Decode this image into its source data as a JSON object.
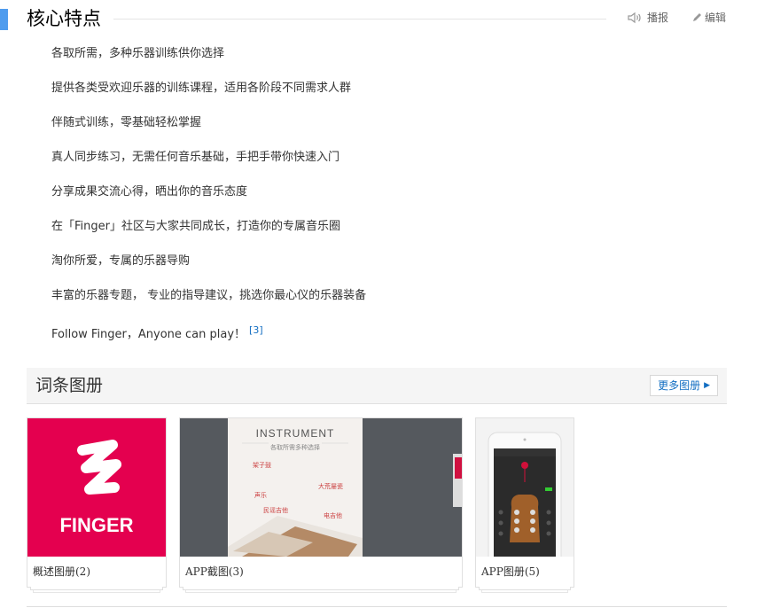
{
  "section": {
    "title": "核心特点",
    "play_label": "播报",
    "edit_label": "编辑"
  },
  "features": [
    "各取所需，多种乐器训练供你选择",
    "提供各类受欢迎乐器的训练课程，适用各阶段不同需求人群",
    "伴随式训练，零基础轻松掌握",
    "真人同步练习，无需任何音乐基础，手把手带你快速入门",
    "分享成果交流心得，晒出你的音乐态度",
    "在「Finger」社区与大家共同成长，打造你的专属音乐圈",
    "淘你所爱，专属的乐器导购",
    "丰富的乐器专题， 专业的指导建议，挑选你最心仪的乐器装备",
    "Follow Finger，Anyone can play！"
  ],
  "feature_ref": "[3]",
  "albums": {
    "title": "词条图册",
    "more_label": "更多图册",
    "items": [
      {
        "caption": "概述图册(2)",
        "logo_text": "FINGER"
      },
      {
        "caption": "APP截图(3)",
        "img_title": "INSTRUMENT",
        "img_sub": "各取所需多种选择",
        "img_labels": [
          "架子鼓",
          "大荒屡瓷",
          "声乐",
          "民谣吉他",
          "电吉他"
        ]
      },
      {
        "caption": "APP图册(5)"
      }
    ]
  },
  "colors": {
    "accent": "#4f9cee",
    "link": "#136ec2",
    "brand_red": "#e4004f"
  }
}
